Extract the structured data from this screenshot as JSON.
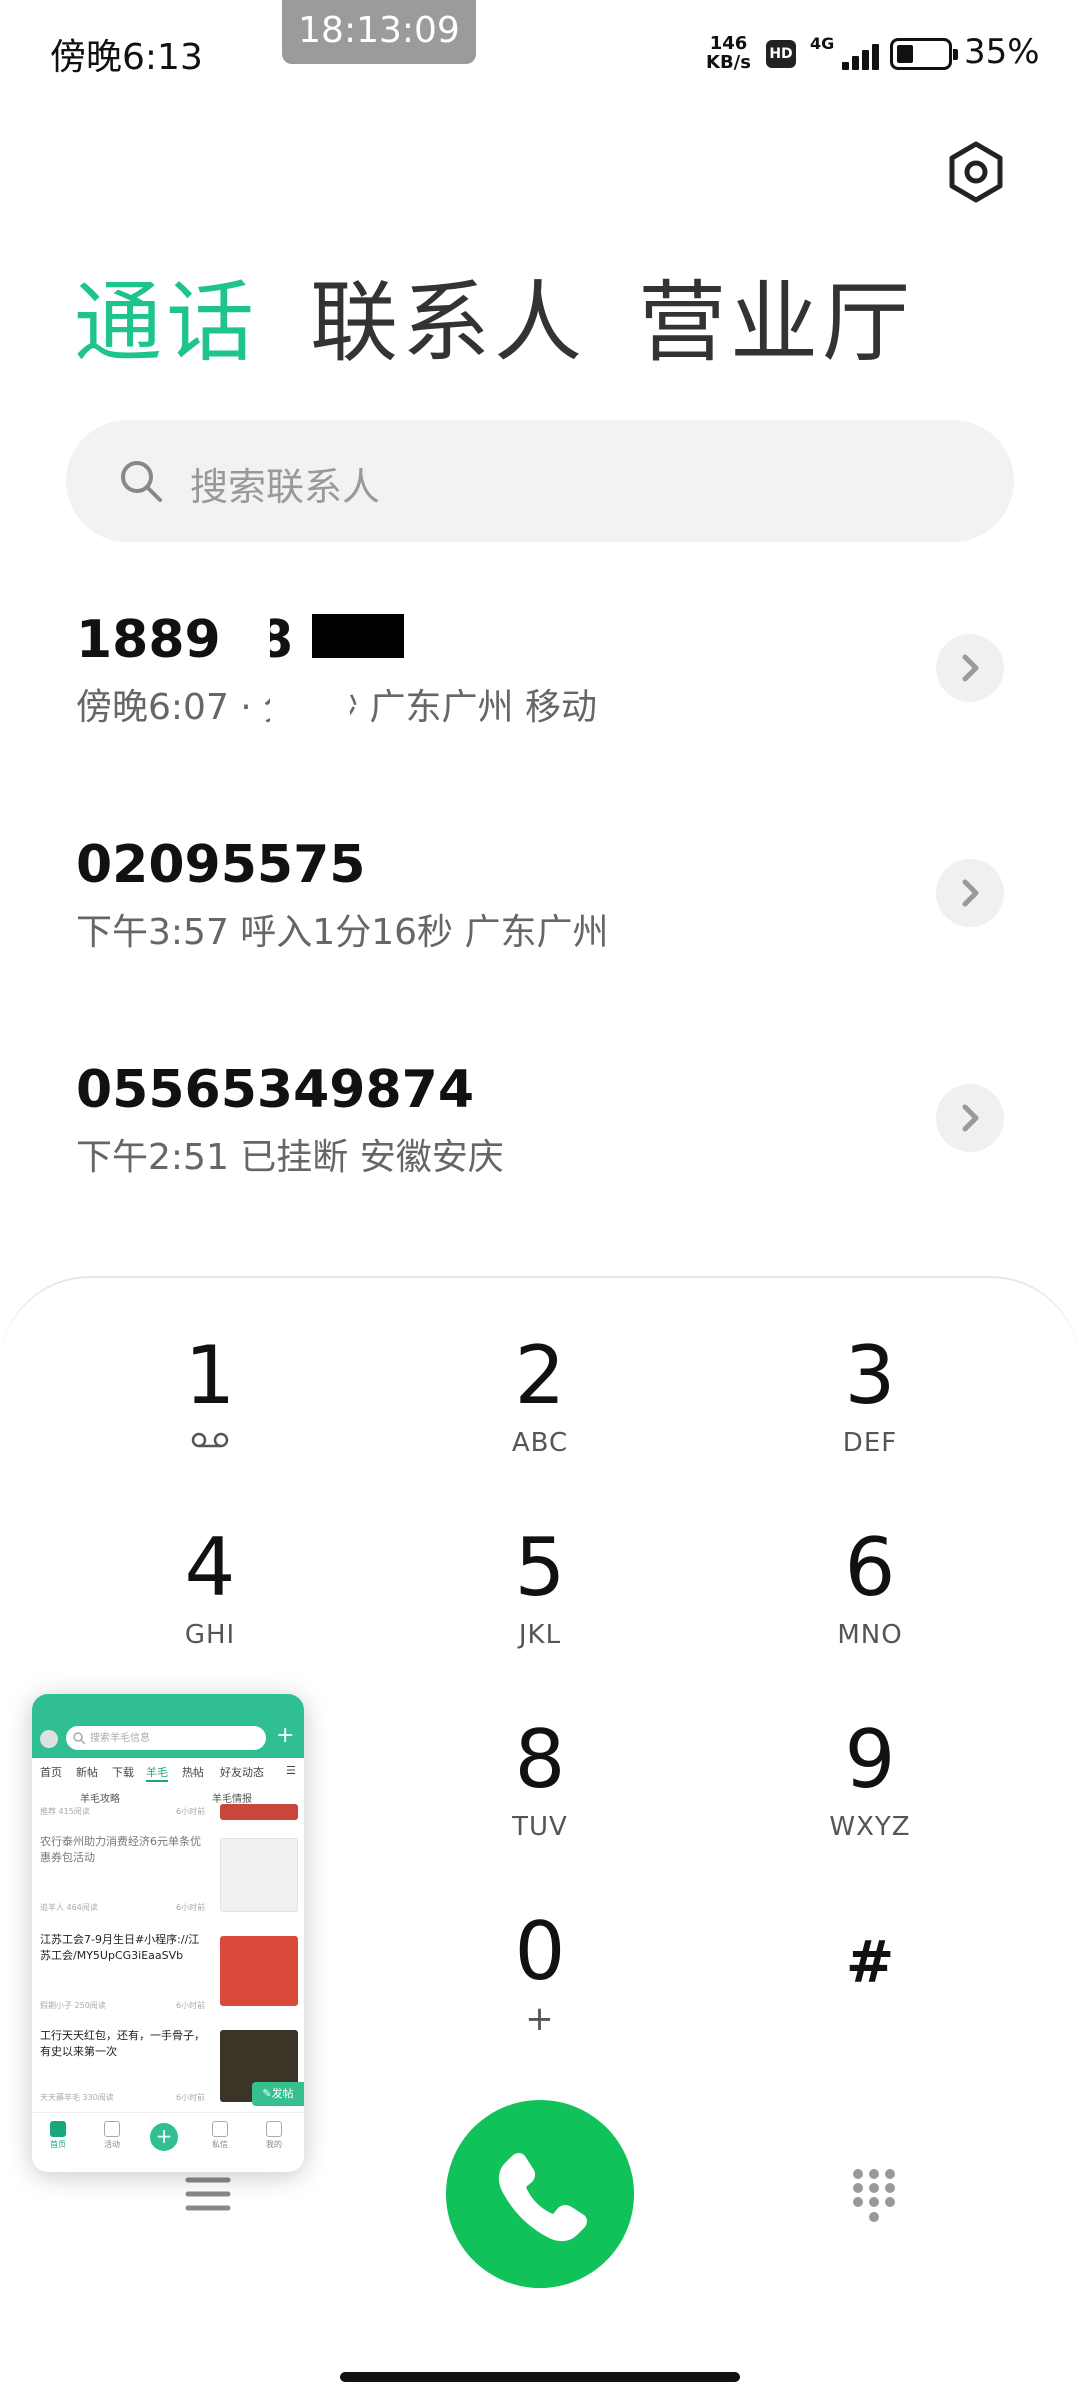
{
  "status_bar": {
    "time": "傍晚6:13",
    "clock_overlay": "18:13:09",
    "net_speed_value": "146",
    "net_speed_unit": "KB/s",
    "hd_badge": "HD",
    "network": "4G",
    "battery_percent": "35%"
  },
  "tabs": [
    {
      "label": "通话",
      "active": true
    },
    {
      "label": "联系人",
      "active": false
    },
    {
      "label": "营业厅",
      "active": false
    }
  ],
  "search": {
    "placeholder": "搜索联系人"
  },
  "call_log": [
    {
      "number": "188988",
      "detail": "傍晚6:07  ·      分5秒  广东广州  移动"
    },
    {
      "number": "02095575",
      "detail": "下午3:57   呼入1分16秒  广东广州"
    },
    {
      "number": "05565349874",
      "detail": "下午2:51   已挂断  安徽安庆"
    }
  ],
  "dialpad": {
    "keys": [
      {
        "digit": "1",
        "letters": ""
      },
      {
        "digit": "2",
        "letters": "ABC"
      },
      {
        "digit": "3",
        "letters": "DEF"
      },
      {
        "digit": "4",
        "letters": "GHI"
      },
      {
        "digit": "5",
        "letters": "JKL"
      },
      {
        "digit": "6",
        "letters": "MNO"
      },
      {
        "digit": "8",
        "letters": "TUV"
      },
      {
        "digit": "9",
        "letters": "WXYZ"
      },
      {
        "digit": "0",
        "letters": "+"
      },
      {
        "digit": "#",
        "letters": ""
      }
    ]
  },
  "colors": {
    "accent": "#1ec48a",
    "call_button": "#11c15a"
  },
  "floating_window": {
    "search_placeholder": "搜索羊毛信息",
    "nav": [
      "首页",
      "新帖",
      "下载",
      "羊毛",
      "热帖",
      "好友动态"
    ],
    "sub_tabs": [
      "羊毛攻略",
      "羊毛情报"
    ],
    "cards": [
      {
        "title": "",
        "meta": "推荐  415阅读",
        "time": "6小时前"
      },
      {
        "title": "农行泰州助力消费经济6元单条优惠券包活动",
        "meta": "追羊人  464阅读",
        "time": "6小时前"
      },
      {
        "title": "江苏工会7-9月生日#小程序://江苏工会/MY5UpCG3iEaaSVb",
        "meta": "假期小子  250阅读",
        "time": "6小时前"
      },
      {
        "title": "工行天天红包，还有，一手骨子，有史以来第一次",
        "meta": "天天薅羊毛  330阅读",
        "time": "6小时前"
      }
    ],
    "post_button": "发帖",
    "bottom_nav": [
      "首页",
      "活动",
      "",
      "私信",
      "我的"
    ]
  }
}
